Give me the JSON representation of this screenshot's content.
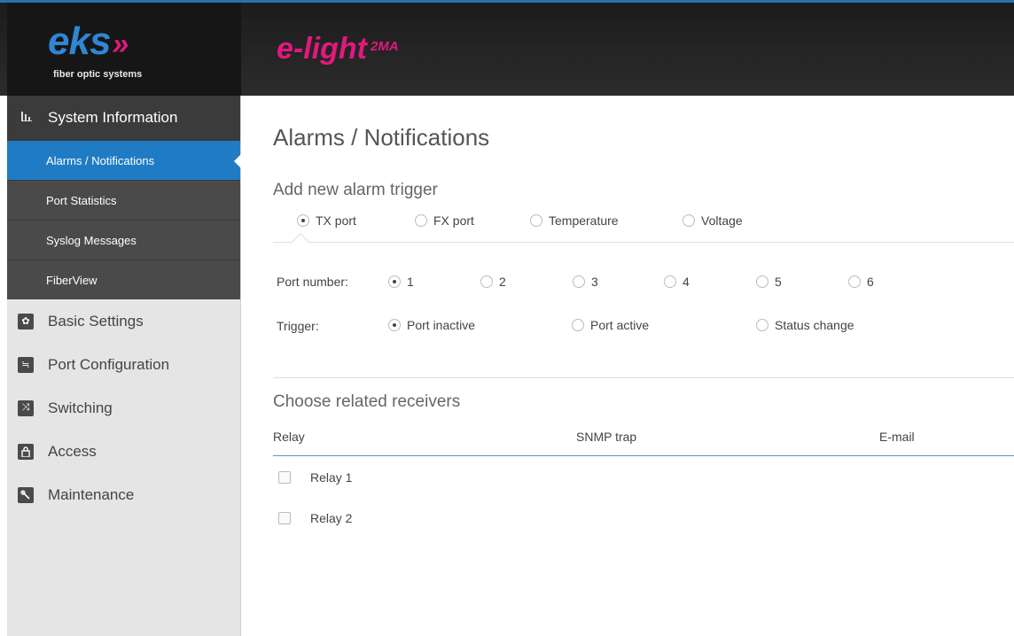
{
  "brand": {
    "logo_text": "eks",
    "logo_arrows": "»",
    "logo_subtitle": "fiber optic systems",
    "product_name": "e-light",
    "product_suffix": "2MA",
    "accent_blue": "#1f7cc4",
    "accent_pink": "#e0197d"
  },
  "sidebar": {
    "section": {
      "label": "System Information",
      "icon": "bar-chart-icon"
    },
    "sub_items": [
      {
        "label": "Alarms / Notifications",
        "active": true
      },
      {
        "label": "Port Statistics",
        "active": false
      },
      {
        "label": "Syslog Messages",
        "active": false
      },
      {
        "label": "FiberView",
        "active": false
      }
    ],
    "items": [
      {
        "label": "Basic Settings",
        "icon": "gear-icon"
      },
      {
        "label": "Port Configuration",
        "icon": "port-config-icon"
      },
      {
        "label": "Switching",
        "icon": "shuffle-icon"
      },
      {
        "label": "Access",
        "icon": "lock-icon"
      },
      {
        "label": "Maintenance",
        "icon": "wrench-icon"
      }
    ]
  },
  "main": {
    "title": "Alarms / Notifications",
    "add_trigger": {
      "heading": "Add new alarm trigger",
      "tabs": [
        {
          "label": "TX port",
          "selected": true
        },
        {
          "label": "FX port",
          "selected": false
        },
        {
          "label": "Temperature",
          "selected": false
        },
        {
          "label": "Voltage",
          "selected": false
        }
      ],
      "port_number": {
        "label": "Port number:",
        "options": [
          {
            "label": "1",
            "selected": true
          },
          {
            "label": "2",
            "selected": false
          },
          {
            "label": "3",
            "selected": false
          },
          {
            "label": "4",
            "selected": false
          },
          {
            "label": "5",
            "selected": false
          },
          {
            "label": "6",
            "selected": false
          }
        ]
      },
      "trigger": {
        "label": "Trigger:",
        "options": [
          {
            "label": "Port inactive",
            "selected": true
          },
          {
            "label": "Port active",
            "selected": false
          },
          {
            "label": "Status change",
            "selected": false
          }
        ]
      }
    },
    "receivers": {
      "heading": "Choose related receivers",
      "columns": [
        "Relay",
        "SNMP trap",
        "E-mail"
      ],
      "relays": [
        {
          "label": "Relay 1",
          "checked": false
        },
        {
          "label": "Relay 2",
          "checked": false
        }
      ]
    }
  }
}
